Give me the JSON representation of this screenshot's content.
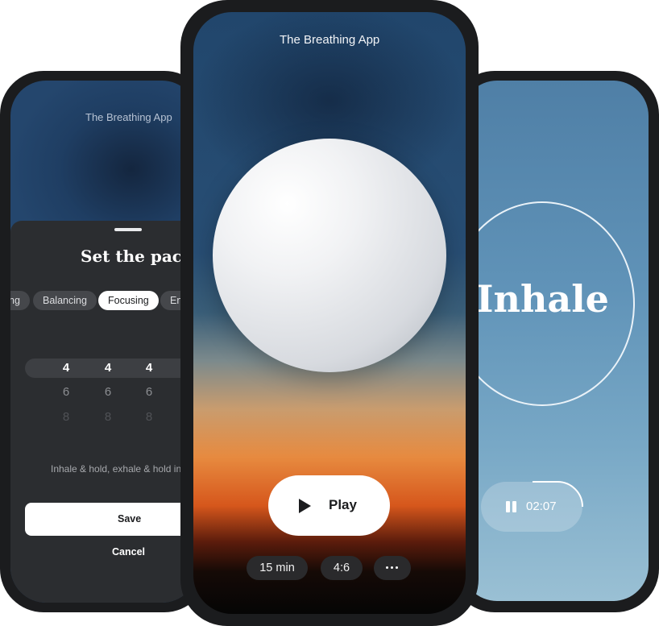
{
  "app_title": "The Breathing App",
  "pace_sheet": {
    "title": "Set the pace",
    "presets": [
      "ng",
      "Balancing",
      "Focusing",
      "En"
    ],
    "selected_preset": "Focusing",
    "picker_rows": [
      [
        "4",
        "4",
        "4"
      ],
      [
        "6",
        "6",
        "6"
      ],
      [
        "8",
        "8",
        "8"
      ]
    ],
    "description": "Inhale & hold, exhale & hold in",
    "save_label": "Save",
    "cancel_label": "Cancel"
  },
  "main_screen": {
    "play_label": "Play",
    "chips": [
      "15 min",
      "4:6",
      "•••"
    ]
  },
  "session_screen": {
    "phase_label": "Inhale",
    "timer": "02:07"
  },
  "colors": {
    "phone_frame": "#1b1c1e",
    "sheet_background": "#2b2d30",
    "sky_blue": "#21466c",
    "sunset_orange": "#e78a3f",
    "session_blue": "#6093b8"
  }
}
